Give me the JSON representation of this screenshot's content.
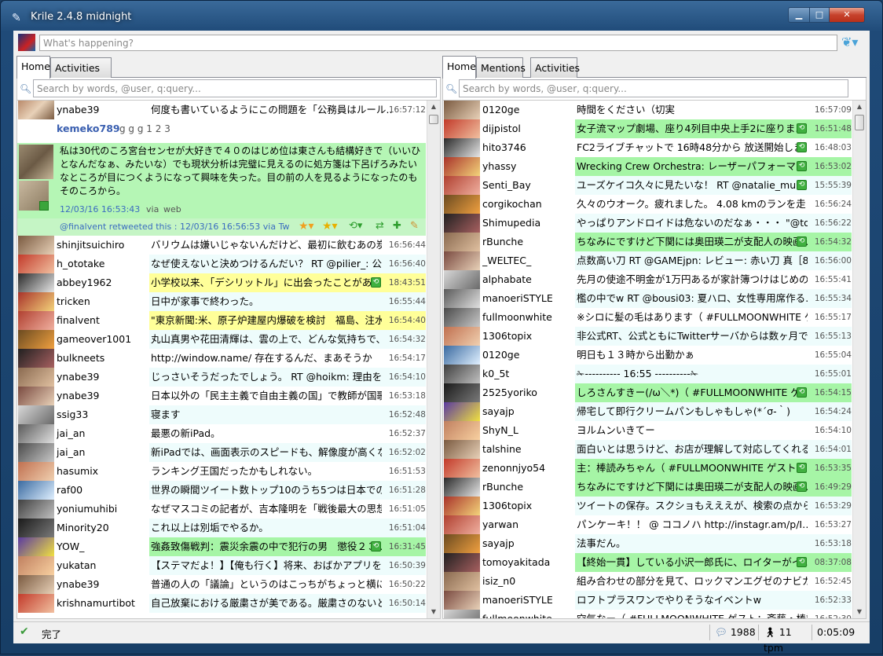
{
  "window": {
    "title": "Krile 2.4.8 midnight",
    "minimize": "▁",
    "maximize": "□",
    "close": "✕"
  },
  "compose": {
    "placeholder": "What's happening?"
  },
  "left": {
    "tabs": [
      "Home",
      "Activities"
    ],
    "search_placeholder": "Search by words, @user, q:query...",
    "first_row": {
      "user": "ynabe39",
      "text": "何度も書いているようにこの問題を「公務員はルール…",
      "time": "16:57:12"
    },
    "expanded": {
      "header_user": "kemeko789",
      "header_text": "g g g 1 2 3",
      "body": "私は30代のころ宮台センセが大好きで４０のはじめ位は東さんも結構好きで（いいひとなんだなぁ、みたいな）でも現状分析は完璧に見えるのに処方箋は下呂げろみたいなところが目につくようになって興味を失った。目の前の人を見るようになったのもそのころから。",
      "timestamp": "12/03/16 16:53:43",
      "via_word": "via",
      "client": "web",
      "retweet_line": "@finalvent  retweeted  this : 12/03/16 16:56:53  via  Tw"
    },
    "rows": [
      {
        "user": "shinjitsuichiro",
        "text": "バリウムは嫌いじゃないんだけど、最初に飲むあの炭…",
        "time": "16:56:44",
        "bg": "#ffffff",
        "rt": false
      },
      {
        "user": "h_ototake",
        "text": "なぜ使えないと決めつけるんだい？ RT @pilier_: 公…",
        "time": "16:56:40",
        "bg": "#eefcfc",
        "rt": false
      },
      {
        "user": "abbey1962",
        "text": "小学校以来、「デシリットル」に出会ったことがあ…",
        "time": "18:43:51",
        "bg": "#ffff99",
        "rt": true
      },
      {
        "user": "tricken",
        "text": "日中が家事で終わった。",
        "time": "16:55:44",
        "bg": "#eefcfc",
        "rt": false
      },
      {
        "user": "finalvent",
        "text": "\"東京新聞:米、原子炉建屋内爆破を検討　福島、注水…",
        "time": "16:54:40",
        "bg": "#ffff99",
        "rt": false
      },
      {
        "user": "gameover1001",
        "text": "丸山真男や花田清輝は、雲の上で、どんな気持ちで、…",
        "time": "16:54:32",
        "bg": "#eefcfc",
        "rt": false
      },
      {
        "user": "bulkneets",
        "text": "http://window.name/ 存在するんだ、まあそうか",
        "time": "16:54:17",
        "bg": "#ffffff",
        "rt": false
      },
      {
        "user": "ynabe39",
        "text": "じっさいそうだったでしょう。 RT @hoikm: 理由を…",
        "time": "16:54:10",
        "bg": "#eefcfc",
        "rt": false
      },
      {
        "user": "ynabe39",
        "text": "日本以外の「民主主義で自由主義の国」で教師が国歌…",
        "time": "16:53:18",
        "bg": "#ffffff",
        "rt": false
      },
      {
        "user": "ssig33",
        "text": "寝ます",
        "time": "16:52:48",
        "bg": "#eefcfc",
        "rt": false
      },
      {
        "user": "jai_an",
        "text": "最悪の新iPad。",
        "time": "16:52:37",
        "bg": "#ffffff",
        "rt": false
      },
      {
        "user": "jai_an",
        "text": "新iPadでは、画面表示のスピードも、解像度が高くな…",
        "time": "16:52:02",
        "bg": "#eefcfc",
        "rt": false
      },
      {
        "user": "hasumix",
        "text": "ランキング王国だったかもしれない。",
        "time": "16:51:53",
        "bg": "#ffffff",
        "rt": false
      },
      {
        "user": "raf00",
        "text": "世界の瞬間ツイート数トップ10のうち5つは日本での…",
        "time": "16:51:28",
        "bg": "#eefcfc",
        "rt": false
      },
      {
        "user": "yoniumuhibi",
        "text": "なぜマスコミの記者が、吉本隆明を「戦後最大の思想…",
        "time": "16:51:05",
        "bg": "#ffffff",
        "rt": false
      },
      {
        "user": "Minority20",
        "text": "これ以上は別垢でやるか。",
        "time": "16:51:04",
        "bg": "#eefcfc",
        "rt": false
      },
      {
        "user": "YOW_",
        "text": "強姦致傷戦判：震災余震の中で犯行の男　懲役２３…",
        "time": "16:31:45",
        "bg": "#a6f5a6",
        "rt": true
      },
      {
        "user": "yukatan",
        "text": "【ステマだよ！】【俺も行く】将来、おばかアプリを…",
        "time": "16:50:39",
        "bg": "#eefcfc",
        "rt": false
      },
      {
        "user": "ynabe39",
        "text": "普通の人の「議論」というのはこっちがちょっと横に…",
        "time": "16:50:22",
        "bg": "#ffffff",
        "rt": false
      },
      {
        "user": "krishnamurtibot",
        "text": "自己放棄における厳粛さが美である。厳粛さのないと…",
        "time": "16:50:14",
        "bg": "#eefcfc",
        "rt": false
      }
    ]
  },
  "right": {
    "tabs": [
      "Home",
      "Mentions",
      "Activities"
    ],
    "search_placeholder": "Search by words, @user, q:query...",
    "rows": [
      {
        "user": "0120ge",
        "text": "時間をください（切実",
        "time": "16:57:09",
        "bg": "#ffffff",
        "rt": false
      },
      {
        "user": "dijpistol",
        "text": "女子流マップ劇場、座り4列目中央上手2に座りま…",
        "time": "16:51:48",
        "bg": "#a6f5a6",
        "rt": true
      },
      {
        "user": "hito3746",
        "text": "FC2ライブチャットで 16時48分から 放送開始しま…",
        "time": "16:48:03",
        "bg": "#ffffff",
        "rt": true
      },
      {
        "user": "yhassy",
        "text": "Wrecking Crew Orchestra: レーザーパフォーマ…",
        "time": "16:53:02",
        "bg": "#a6f5a6",
        "rt": true
      },
      {
        "user": "Senti_Bay",
        "text": "ユーズケイコ久々に見たいな！ RT @natalie_mu…",
        "time": "15:55:39",
        "bg": "#eefcfc",
        "rt": true
      },
      {
        "user": "corgikochan",
        "text": "久々のウオーク。疲れました。 4.08 kmのランを走り…",
        "time": "16:56:24",
        "bg": "#ffffff",
        "rt": false
      },
      {
        "user": "Shimupedia",
        "text": "やっぱりアンドロイドは危ないのだなぁ・・・ \"@to…",
        "time": "16:56:22",
        "bg": "#eefcfc",
        "rt": false
      },
      {
        "user": "rBunche",
        "text": "ちなみにですけど下関には奥田瑛二が支配人の映画…",
        "time": "16:54:32",
        "bg": "#a6f5a6",
        "rt": true
      },
      {
        "user": "_WELTEC_",
        "text": "点数高い刀 RT @GAMEjpn: レビュー: 赤い刀 真［8…",
        "time": "16:56:00",
        "bg": "#eefcfc",
        "rt": false
      },
      {
        "user": "alphabate",
        "text": "先月の使途不明金が1万円あるが家計簿つけはじめの…",
        "time": "16:55:41",
        "bg": "#ffffff",
        "rt": false
      },
      {
        "user": "manoeriSTYLE",
        "text": "檻の中でw RT @bousi03: 夏ハロ、女性専用席作る…",
        "time": "16:55:34",
        "bg": "#eefcfc",
        "rt": false
      },
      {
        "user": "fullmoonwhite",
        "text": "※シロに髪の毛はあります（ #FULLMOONWHITE ゲ…",
        "time": "16:55:17",
        "bg": "#ffffff",
        "rt": false
      },
      {
        "user": "1306topix",
        "text": "非公式RT、公式ともにTwitterサーバからは数ヶ月で…",
        "time": "16:55:13",
        "bg": "#eefcfc",
        "rt": false
      },
      {
        "user": "0120ge",
        "text": "明日も１３時から出勤かぁ",
        "time": "16:55:04",
        "bg": "#ffffff",
        "rt": false
      },
      {
        "user": "k0_5t",
        "text": "✁---------- 16:55 ----------✁",
        "time": "16:55:01",
        "bg": "#eefcfc",
        "rt": false
      },
      {
        "user": "2525yoriko",
        "text": "しろさんすきー(/ω＼*)（ #FULLMOONWHITE ゲ…",
        "time": "16:54:15",
        "bg": "#a6f5a6",
        "rt": true
      },
      {
        "user": "sayajp",
        "text": "帰宅して即行クリームパンもしゃもしゃ(*´σ-｀)",
        "time": "16:54:24",
        "bg": "#eefcfc",
        "rt": false
      },
      {
        "user": "ShyN_L",
        "text": "ヨルムンいきてー",
        "time": "16:54:10",
        "bg": "#ffffff",
        "rt": false
      },
      {
        "user": "talshine",
        "text": "面白いとは思うけど、お店が理解して対応してくれる…",
        "time": "16:54:01",
        "bg": "#eefcfc",
        "rt": false
      },
      {
        "user": "zenonnjyo54",
        "text": "主：棒読みちゃん（ #FULLMOONWHITE ゲスト…",
        "time": "16:53:35",
        "bg": "#a6f5a6",
        "rt": true
      },
      {
        "user": "rBunche",
        "text": "ちなみにですけど下関には奥田瑛二が支配人の映画…",
        "time": "16:49:29",
        "bg": "#a6f5a6",
        "rt": true
      },
      {
        "user": "1306topix",
        "text": "ツイートの保存。スクショもえええが、検索の点からア…",
        "time": "16:53:29",
        "bg": "#eefcfc",
        "rt": false
      },
      {
        "user": "yarwan",
        "text": "パンケーキ！！ @ ココノハ http://instagr.am/p/I…",
        "time": "16:53:27",
        "bg": "#ffffff",
        "rt": false
      },
      {
        "user": "sayajp",
        "text": "法事だん。",
        "time": "16:53:18",
        "bg": "#eefcfc",
        "rt": false
      },
      {
        "user": "tomoyakitada",
        "text": "【終始一貫】している小沢一郎氏に、ロイターがイ…",
        "time": "08:37:08",
        "bg": "#a6f5a6",
        "rt": true
      },
      {
        "user": "isiz_n0",
        "text": "組み合わせの部分を見て、ロックマンエグゼのナビカ…",
        "time": "16:52:45",
        "bg": "#ffffff",
        "rt": false
      },
      {
        "user": "manoeriSTYLE",
        "text": "ロフトプラスワンでやりそうなイベントw",
        "time": "16:52:33",
        "bg": "#eefcfc",
        "rt": false
      },
      {
        "user": "fullmoonwhite",
        "text": "空気なー（ #FULLMOONWHITE ゲスト：斎藤・棒読…",
        "time": "16:52:30",
        "bg": "#ffffff",
        "rt": false
      }
    ]
  },
  "status": {
    "text": "完了",
    "tweets": "1988",
    "tpm": "11 tpm",
    "elapsed": "0:05:09"
  }
}
